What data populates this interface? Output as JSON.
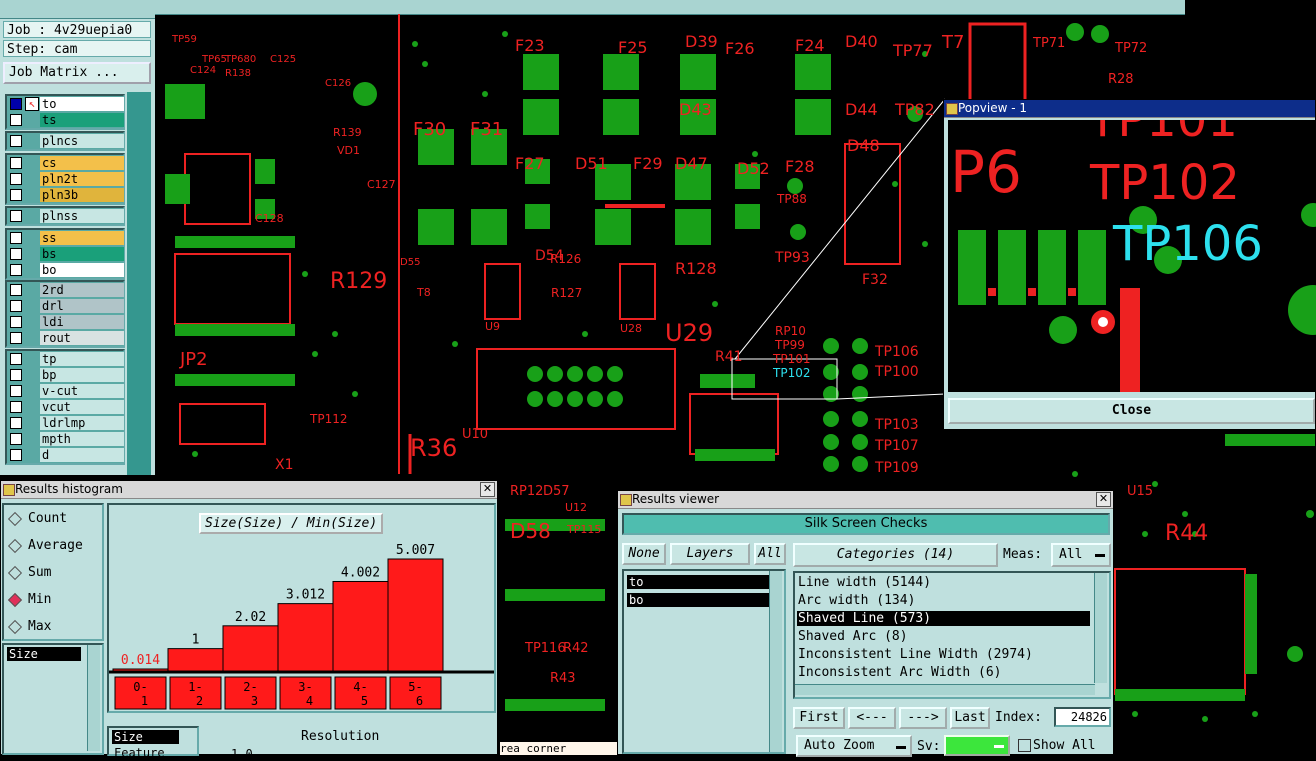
{
  "left_panel": {
    "job_label": "Job : 4v29uepia0",
    "step_label": "Step: cam",
    "job_matrix_button": "Job Matrix ...",
    "layer_groups": [
      [
        {
          "name": "to",
          "color": "#ffffff",
          "selected": true
        },
        {
          "name": "ts",
          "color": "#1aa07a"
        }
      ],
      [
        {
          "name": "plncs",
          "color": "#c7e6e3"
        }
      ],
      [
        {
          "name": "cs",
          "color": "#f3c04a"
        },
        {
          "name": "pln2t",
          "color": "#f3c04a"
        },
        {
          "name": "pln3b",
          "color": "#e0b43c"
        }
      ],
      [
        {
          "name": "plnss",
          "color": "#c7e6e3"
        }
      ],
      [
        {
          "name": "ss",
          "color": "#f3c04a"
        },
        {
          "name": "bs",
          "color": "#1aa07a"
        },
        {
          "name": "bo",
          "color": "#ffffff"
        }
      ],
      [
        {
          "name": "2rd",
          "color": "#b0c4c8"
        },
        {
          "name": "drl",
          "color": "#b0c4c8"
        },
        {
          "name": "ldi",
          "color": "#b0c4c8"
        },
        {
          "name": "rout",
          "color": "#d8e2e2"
        }
      ],
      [
        {
          "name": "tp",
          "color": "#c7e6e3"
        },
        {
          "name": "bp",
          "color": "#c7e6e3"
        },
        {
          "name": "v-cut",
          "color": "#c7e6e3"
        },
        {
          "name": "vcut",
          "color": "#c7e6e3"
        },
        {
          "name": "ldrlmp",
          "color": "#c7e6e3"
        },
        {
          "name": "mpth",
          "color": "#c7e6e3"
        },
        {
          "name": "d",
          "color": "#c7e6e3"
        }
      ]
    ]
  },
  "pcb_labels": [
    "TP59",
    "TP65",
    "TP680",
    "C125",
    "C124",
    "R138",
    "C126",
    "F23",
    "F25",
    "D39",
    "F26",
    "F24",
    "D40",
    "TP77",
    "T7",
    "TP71",
    "TP72",
    "R28",
    "TP82",
    "F30",
    "F31",
    "D43",
    "D44",
    "R139",
    "VD1",
    "C127",
    "F27",
    "D51",
    "F29",
    "D47",
    "D52",
    "F28",
    "D48",
    "TP88",
    "C128",
    "D54",
    "TP93",
    "D55",
    "R126",
    "R128",
    "F32",
    "T8",
    "R127",
    "R129",
    "U9",
    "U28",
    "U29",
    "JP2",
    "RP10",
    "TP99",
    "TP101",
    "TP102",
    "TP106",
    "TP100",
    "TP103",
    "TP107",
    "TP109",
    "TP112",
    "U10",
    "R36",
    "X1",
    "RP12",
    "D57",
    "D58",
    "U12",
    "TP115",
    "TP116",
    "R42",
    "R43",
    "R44",
    "U15",
    "R41",
    "P6"
  ],
  "popview": {
    "title": "Popview - 1",
    "close_button": "Close",
    "big_labels": [
      "P6",
      "TP101",
      "TP102",
      "TP106"
    ]
  },
  "histogram": {
    "title": "Results histogram",
    "modes": [
      {
        "label": "Count",
        "selected": false
      },
      {
        "label": "Average",
        "selected": false
      },
      {
        "label": "Sum",
        "selected": false
      },
      {
        "label": "Min",
        "selected": true
      },
      {
        "label": "Max",
        "selected": false
      }
    ],
    "field_list": [
      "Size"
    ],
    "chart_caption": "Size(Size) / Min(Size)",
    "bottom_list": [
      "Size",
      "Feature"
    ],
    "resolution_label": "Resolution",
    "resolution_value": "1.0",
    "chart_data": {
      "type": "bar",
      "title": "Size(Size) / Min(Size)",
      "categories": [
        "0-1",
        "1-2",
        "2-3",
        "3-4",
        "4-5",
        "5-6"
      ],
      "values": [
        0.014,
        1,
        2.02,
        3.012,
        4.002,
        5.007
      ],
      "value_labels": [
        "0.014",
        "1",
        "2.02",
        "3.012",
        "4.002",
        "5.007"
      ],
      "ylim": [
        0,
        5.007
      ]
    }
  },
  "results_viewer": {
    "title": "Results viewer",
    "heading": "Silk Screen Checks",
    "none_button": "None",
    "layers_button": "Layers",
    "all_button": "All",
    "layers": [
      "to",
      "bo"
    ],
    "categories_button": "Categories (14)",
    "meas_label": "Meas:",
    "meas_value": "All",
    "categories": [
      {
        "label": "Line width (5144)",
        "selected": false
      },
      {
        "label": "Arc width (134)",
        "selected": false
      },
      {
        "label": "Shaved Line (573)",
        "selected": true
      },
      {
        "label": "Shaved Arc (8)",
        "selected": false
      },
      {
        "label": "Inconsistent Line Width (2974)",
        "selected": false
      },
      {
        "label": "Inconsistent Arc Width (6)",
        "selected": false
      }
    ],
    "first_button": "First",
    "prev_button": "<---",
    "next_button": "--->",
    "last_button": "Last",
    "index_label": "Index:",
    "index_value": "24826",
    "auto_zoom_button": "Auto Zoom",
    "sv_label": "Sv:",
    "show_all_label": "Show All"
  },
  "status_fragment": "rea corner",
  "colors": {
    "panel": "#bfe0de",
    "pcb_red": "#e22222",
    "pad_green": "#18a018",
    "cyan_text": "#2de0ee",
    "title_active": "#0d2d8a"
  }
}
